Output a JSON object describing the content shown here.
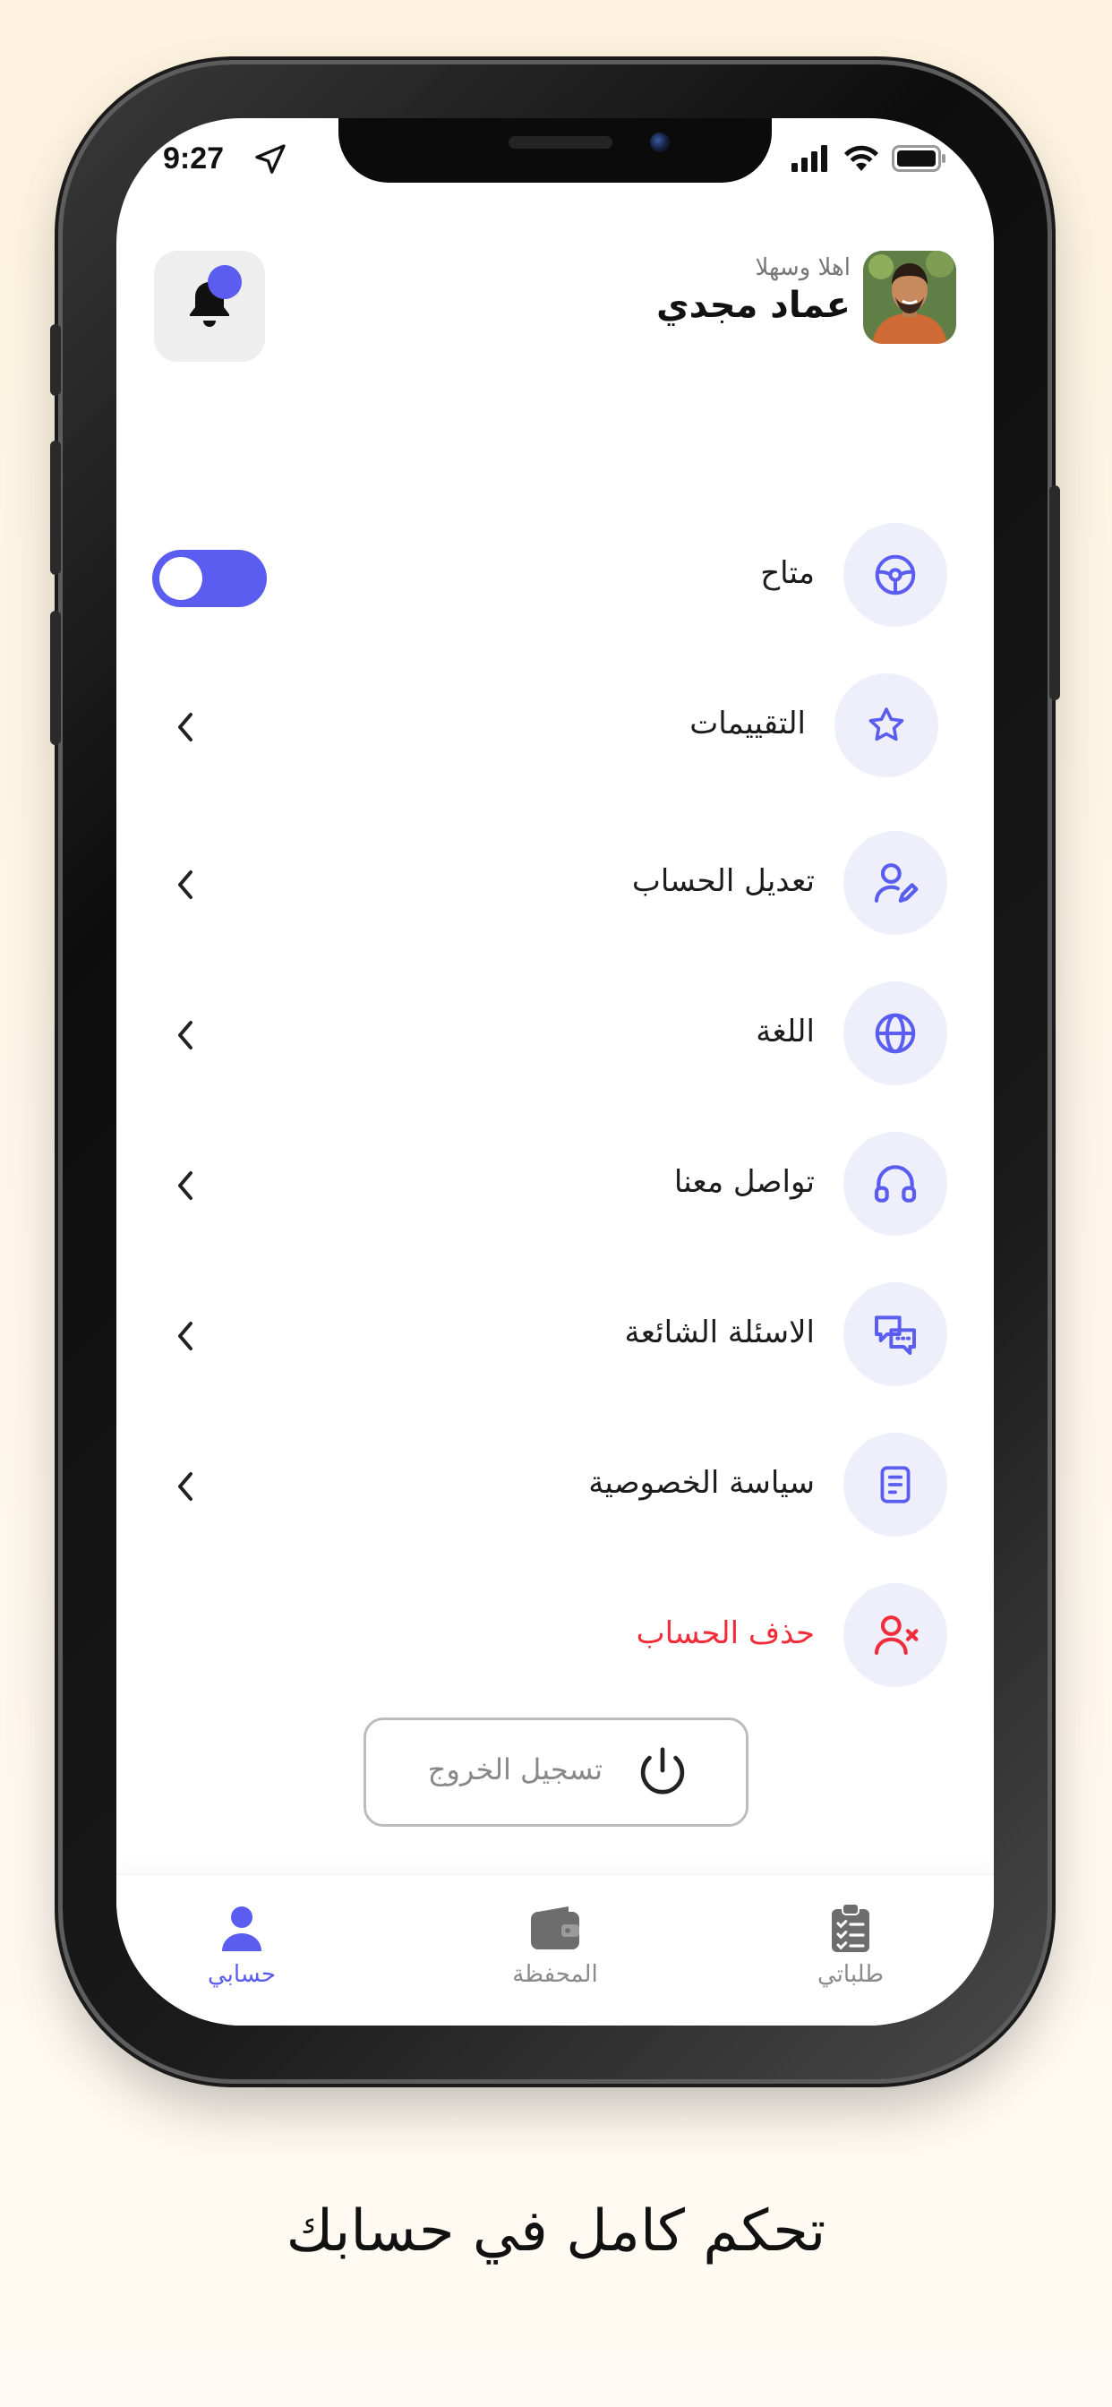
{
  "status_bar": {
    "time": "9:27",
    "location_icon": "location-arrow-icon",
    "signal_icon": "signal-bars-icon",
    "wifi_icon": "wifi-icon",
    "battery_icon": "battery-icon"
  },
  "header": {
    "greeting": "اهلا وسهلا",
    "user_name": "عماد مجدي",
    "notification_icon": "bell-icon"
  },
  "menu": {
    "items": [
      {
        "label": "متاح",
        "icon": "steering-wheel-icon",
        "control": "toggle",
        "toggle_on": true
      },
      {
        "label": "التقييمات",
        "icon": "star-icon",
        "control": "chevron"
      },
      {
        "label": "تعديل الحساب",
        "icon": "user-edit-icon",
        "control": "chevron"
      },
      {
        "label": "اللغة",
        "icon": "globe-icon",
        "control": "chevron"
      },
      {
        "label": "تواصل معنا",
        "icon": "headset-icon",
        "control": "chevron"
      },
      {
        "label": "الاسئلة الشائعة",
        "icon": "chat-bubbles-icon",
        "control": "chevron"
      },
      {
        "label": "سياسة الخصوصية",
        "icon": "document-icon",
        "control": "chevron"
      },
      {
        "label": "حذف الحساب",
        "icon": "user-remove-icon",
        "control": "none",
        "danger": true
      }
    ]
  },
  "logout": {
    "label": "تسجيل الخروج",
    "icon": "power-icon"
  },
  "bottom_nav": {
    "items": [
      {
        "label": "حسابي",
        "icon": "user-icon",
        "active": true
      },
      {
        "label": "المحفظة",
        "icon": "wallet-icon",
        "active": false
      },
      {
        "label": "طلباتي",
        "icon": "clipboard-list-icon",
        "active": false
      }
    ]
  },
  "caption": "تحكم كامل في حسابك",
  "colors": {
    "accent": "#5a5df0",
    "danger": "#f02d3a",
    "icon_bg": "#efeffb",
    "background": "#fdf2de"
  }
}
